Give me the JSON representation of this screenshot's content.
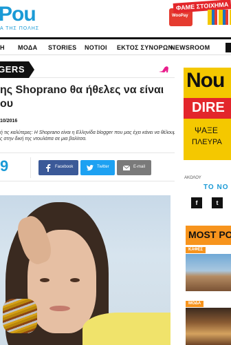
{
  "header": {
    "logo_text": "Pou",
    "logo_sub": "Α ΤΗΣ ΠΟΛΗΣ",
    "promo_ribbon": "ΦΑΜΕ ΣΤΟΙΧΗΜΑ",
    "promo_card": "WooPay"
  },
  "nav": {
    "items": [
      "Η",
      "ΜΟΔΑ",
      "STORIES",
      "ΝΟΤΙΟΙ",
      "ΕΚΤΟΣ ΣΥΝΟΡΩΝ",
      "NEWSROOM"
    ]
  },
  "section": {
    "tag": "GGERS"
  },
  "article": {
    "title_line1": "ης Shoprano θα ήθελες να είναι",
    "title_line2": "ου",
    "date": "10/2016",
    "lead_line1": "ή τις καλύτερες: Η Shoprano είναι η Ελληνίδα blogger που μας έχει κάνει να θέλουμε",
    "lead_line2": "ς στην δική της ντουλάπα σε μια βαλίτσα.",
    "share_count": "9",
    "share_buttons": {
      "facebook": "Facebook",
      "twitter": "Twitter",
      "email": "E-mail"
    }
  },
  "sidebar": {
    "ad": {
      "line1": "Nou",
      "line2": "DIRE",
      "line3": "ΨΑΞΕ",
      "line4": "ΠΛΕΥΡΑ"
    },
    "follow_label": "ΑΚΟΛΟΥ",
    "follow_to": "ΤΟ ΝΟ",
    "social": {
      "facebook": "f",
      "twitter": "t"
    },
    "most_popular": "MOST POP",
    "cards": [
      {
        "tag": "ΚΑΦΕΣ"
      },
      {
        "tag": "ΜΟΔΑ"
      }
    ]
  },
  "colors": {
    "brand_blue": "#1a9ad6",
    "facebook": "#3b5998",
    "twitter": "#1da1f2",
    "email": "#7a7a7a",
    "accent_orange": "#f7941d",
    "ad_yellow": "#f4c800",
    "ad_red": "#e3262b"
  }
}
